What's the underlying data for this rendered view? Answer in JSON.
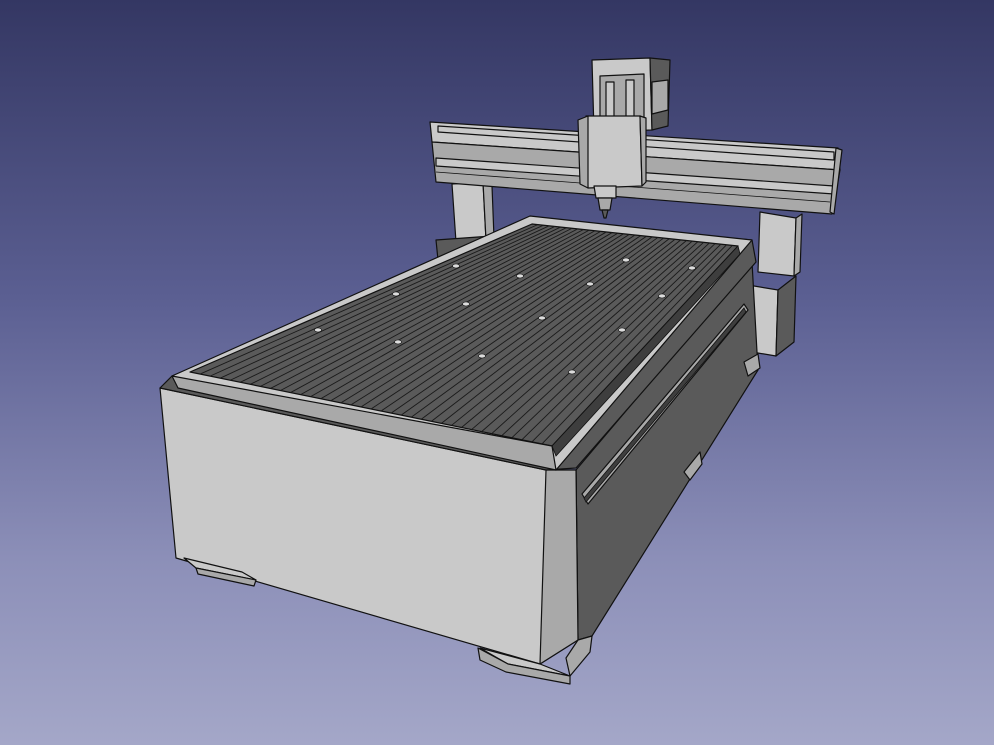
{
  "viewport": {
    "background_top": "#343763",
    "background_bottom": "#a4a7c8",
    "model_colors": {
      "light_face": "#c9c9c9",
      "mid_face": "#a9a9a9",
      "dark_face": "#5a5a5a",
      "edge": "#111111"
    }
  }
}
